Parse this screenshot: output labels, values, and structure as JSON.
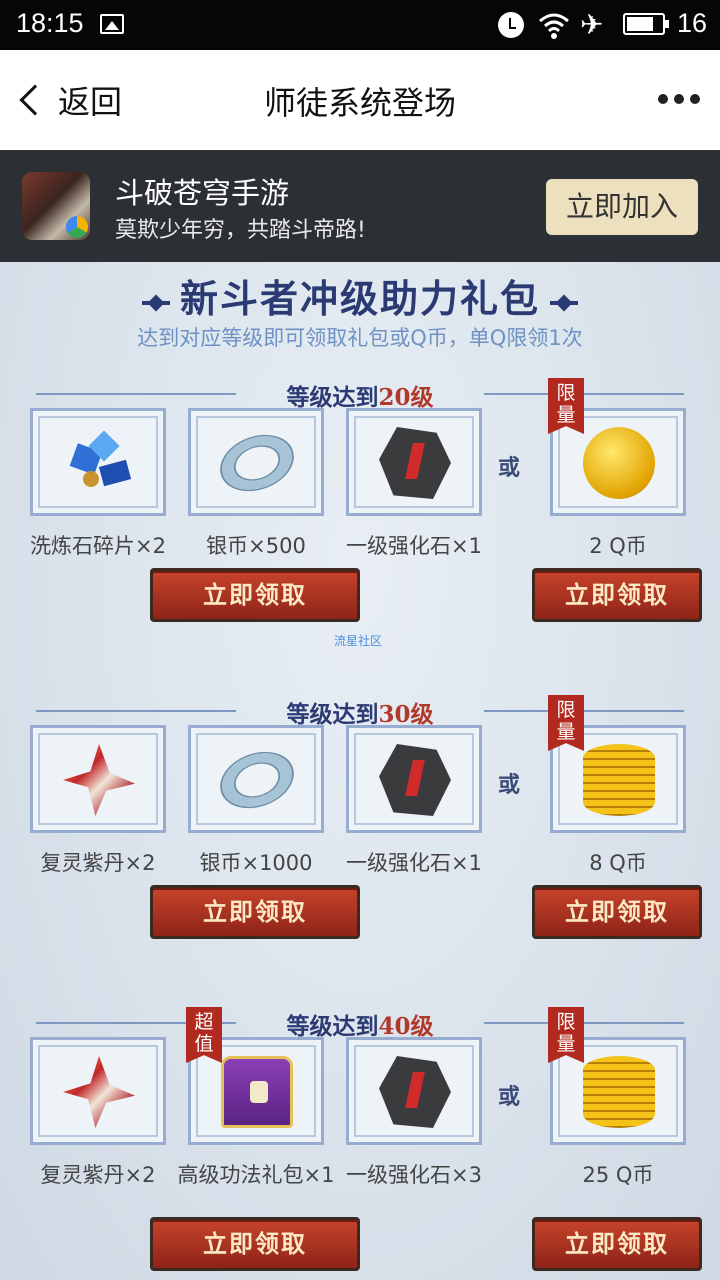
{
  "status_bar": {
    "time": "18:15",
    "battery_level": "16"
  },
  "nav": {
    "back_label": "返回",
    "title": "师徒系统登场"
  },
  "banner": {
    "game_name": "斗破苍穹手游",
    "slogan": "莫欺少年穷，共踏斗帝路!",
    "join_label": "立即加入"
  },
  "promo": {
    "headline": "新斗者冲级助力礼包",
    "subline": "达到对应等级即可领取礼包或Q币，单Q限领1次",
    "or_label": "或",
    "limited_label": "限量",
    "super_label": "超值",
    "claim_label": "立即领取",
    "watermark": "流星社区",
    "sections": [
      {
        "prefix": "等级达到",
        "level": "20",
        "suffix": "级",
        "items": [
          {
            "name": "洗炼石碎片×2",
            "icon": "shard-icon"
          },
          {
            "name": "银币×500",
            "icon": "silver-coin-icon"
          },
          {
            "name": "一级强化石×1",
            "icon": "stone-icon"
          }
        ],
        "alt": {
          "name": "2 Q币",
          "icon": "qcoin-icon"
        }
      },
      {
        "prefix": "等级达到",
        "level": "30",
        "suffix": "级",
        "items": [
          {
            "name": "复灵紫丹×2",
            "icon": "pill-icon"
          },
          {
            "name": "银币×1000",
            "icon": "silver-coin-icon"
          },
          {
            "name": "一级强化石×1",
            "icon": "stone-icon"
          }
        ],
        "alt": {
          "name": "8 Q币",
          "icon": "qcoin-stack-icon"
        }
      },
      {
        "prefix": "等级达到",
        "level": "40",
        "suffix": "级",
        "items": [
          {
            "name": "复灵紫丹×2",
            "icon": "pill-icon"
          },
          {
            "name": "高级功法礼包×1",
            "icon": "chest-icon"
          },
          {
            "name": "一级强化石×3",
            "icon": "stone-icon"
          }
        ],
        "alt": {
          "name": "25 Q币",
          "icon": "qcoin-stack-icon"
        }
      }
    ]
  }
}
